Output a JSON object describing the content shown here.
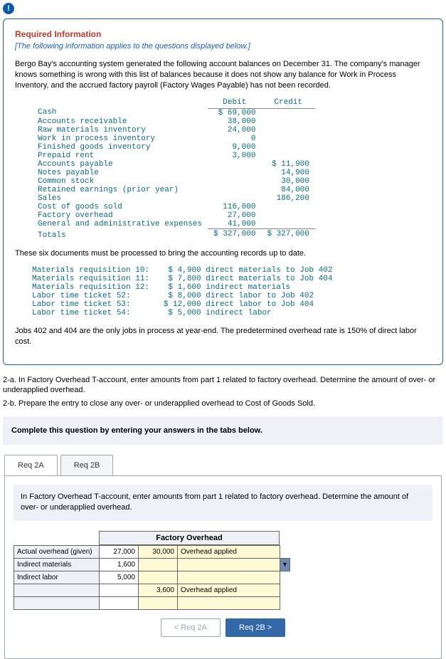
{
  "alert_glyph": "!",
  "card": {
    "title": "Required Information",
    "intro": "[The following information applies to the questions displayed below.]",
    "para1": "Bergo Bay's accounting system generated the following account balances on December 31. The company's manager knows something is wrong with this list of balances because it does not show any balance for Work in Process Inventory, and the accrued factory payroll (Factory Wages Payable) has not been recorded.",
    "table_headers": {
      "debit": "Debit",
      "credit": "Credit"
    },
    "rows": [
      {
        "name": "Cash",
        "debit": "$ 69,000",
        "credit": ""
      },
      {
        "name": "Accounts receivable",
        "debit": "38,000",
        "credit": ""
      },
      {
        "name": "Raw materials inventory",
        "debit": "24,000",
        "credit": ""
      },
      {
        "name": "Work in process inventory",
        "debit": "0",
        "credit": ""
      },
      {
        "name": "Finished goods inventory",
        "debit": "9,000",
        "credit": ""
      },
      {
        "name": "Prepaid rent",
        "debit": "3,000",
        "credit": ""
      },
      {
        "name": "Accounts payable",
        "debit": "",
        "credit": "$ 11,900"
      },
      {
        "name": "Notes payable",
        "debit": "",
        "credit": "14,900"
      },
      {
        "name": "Common stock",
        "debit": "",
        "credit": "30,000"
      },
      {
        "name": "Retained earnings (prior year)",
        "debit": "",
        "credit": "84,000"
      },
      {
        "name": "Sales",
        "debit": "",
        "credit": "186,200"
      },
      {
        "name": "Cost of goods sold",
        "debit": "116,000",
        "credit": ""
      },
      {
        "name": "Factory overhead",
        "debit": "27,000",
        "credit": ""
      },
      {
        "name": "General and administrative expenses",
        "debit": "41,000",
        "credit": ""
      }
    ],
    "totals": {
      "name": "Totals",
      "debit": "$ 327,000",
      "credit": "$ 327,000"
    },
    "para2": "These six documents must be processed to bring the accounting records up to date.",
    "docs": [
      "Materials requisition 10:    $ 4,900 direct materials to Job 402",
      "Materials requisition 11:    $ 7,800 direct materials to Job 404",
      "Materials requisition 12:    $ 1,600 indirect materials",
      "Labor time ticket 52:        $ 8,000 direct labor to Job 402",
      "Labor time ticket 53:       $ 12,000 direct labor to Job 404",
      "Labor time ticket 54:        $ 5,000 indirect labor"
    ],
    "para3": "Jobs 402 and 404 are the only jobs in process at year-end. The predetermined overhead rate is 150% of direct labor cost."
  },
  "q2a": "2-a. In Factory Overhead T-account, enter amounts from part 1 related to factory overhead. Determine the amount of over- or underapplied overhead.",
  "q2b": "2-b. Prepare the entry to close any over- or underapplied overhead to Cost of Goods Sold.",
  "instruction": "Complete this question by entering your answers in the tabs below.",
  "tabs": {
    "a": "Req 2A",
    "b": "Req 2B"
  },
  "tab_desc": "In Factory Overhead T-account, enter amounts from part 1 related to factory overhead. Determine the amount of over- or underapplied overhead.",
  "t_account": {
    "title": "Factory Overhead",
    "debit_rows": [
      {
        "label": "Actual overhead (given)",
        "val": "27,000"
      },
      {
        "label": "Indirect materials",
        "val": "1,600"
      },
      {
        "label": "Indirect labor",
        "val": "5,000"
      },
      {
        "label": "",
        "val": ""
      },
      {
        "label": "",
        "val": ""
      }
    ],
    "credit_rows": [
      {
        "val": "30,000",
        "label": "Overhead applied"
      },
      {
        "val": "",
        "label": ""
      },
      {
        "val": "",
        "label": ""
      },
      {
        "val": "3,600",
        "label": "Overhead applied"
      },
      {
        "val": "",
        "label": ""
      }
    ]
  },
  "nav": {
    "prev": "<  Req 2A",
    "next": "Req 2B  >"
  }
}
